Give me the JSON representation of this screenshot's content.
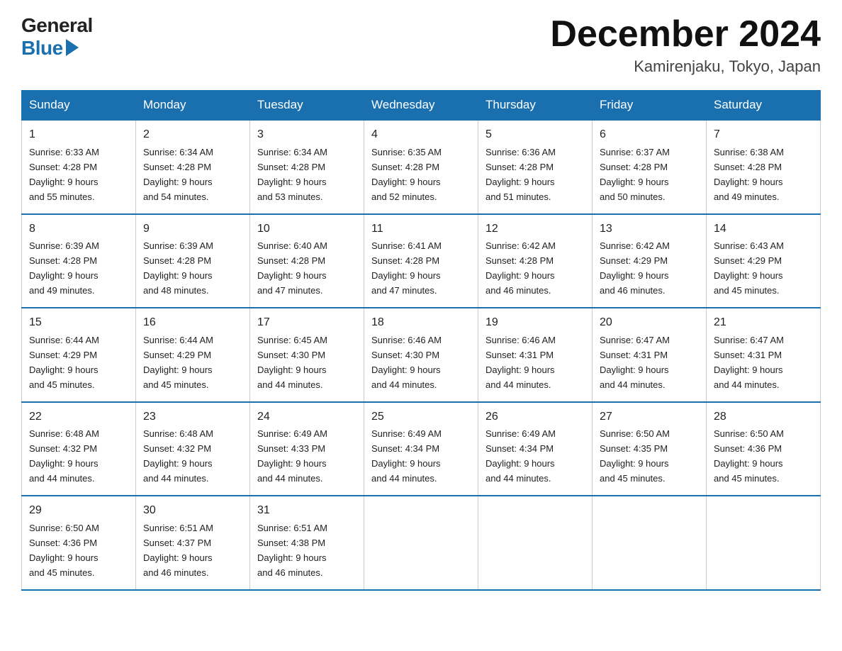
{
  "header": {
    "logo_line1": "General",
    "logo_line2": "Blue",
    "month_title": "December 2024",
    "location": "Kamirenjaku, Tokyo, Japan"
  },
  "days_of_week": [
    "Sunday",
    "Monday",
    "Tuesday",
    "Wednesday",
    "Thursday",
    "Friday",
    "Saturday"
  ],
  "weeks": [
    [
      {
        "day": "1",
        "sunrise": "6:33 AM",
        "sunset": "4:28 PM",
        "daylight": "9 hours and 55 minutes."
      },
      {
        "day": "2",
        "sunrise": "6:34 AM",
        "sunset": "4:28 PM",
        "daylight": "9 hours and 54 minutes."
      },
      {
        "day": "3",
        "sunrise": "6:34 AM",
        "sunset": "4:28 PM",
        "daylight": "9 hours and 53 minutes."
      },
      {
        "day": "4",
        "sunrise": "6:35 AM",
        "sunset": "4:28 PM",
        "daylight": "9 hours and 52 minutes."
      },
      {
        "day": "5",
        "sunrise": "6:36 AM",
        "sunset": "4:28 PM",
        "daylight": "9 hours and 51 minutes."
      },
      {
        "day": "6",
        "sunrise": "6:37 AM",
        "sunset": "4:28 PM",
        "daylight": "9 hours and 50 minutes."
      },
      {
        "day": "7",
        "sunrise": "6:38 AM",
        "sunset": "4:28 PM",
        "daylight": "9 hours and 49 minutes."
      }
    ],
    [
      {
        "day": "8",
        "sunrise": "6:39 AM",
        "sunset": "4:28 PM",
        "daylight": "9 hours and 49 minutes."
      },
      {
        "day": "9",
        "sunrise": "6:39 AM",
        "sunset": "4:28 PM",
        "daylight": "9 hours and 48 minutes."
      },
      {
        "day": "10",
        "sunrise": "6:40 AM",
        "sunset": "4:28 PM",
        "daylight": "9 hours and 47 minutes."
      },
      {
        "day": "11",
        "sunrise": "6:41 AM",
        "sunset": "4:28 PM",
        "daylight": "9 hours and 47 minutes."
      },
      {
        "day": "12",
        "sunrise": "6:42 AM",
        "sunset": "4:28 PM",
        "daylight": "9 hours and 46 minutes."
      },
      {
        "day": "13",
        "sunrise": "6:42 AM",
        "sunset": "4:29 PM",
        "daylight": "9 hours and 46 minutes."
      },
      {
        "day": "14",
        "sunrise": "6:43 AM",
        "sunset": "4:29 PM",
        "daylight": "9 hours and 45 minutes."
      }
    ],
    [
      {
        "day": "15",
        "sunrise": "6:44 AM",
        "sunset": "4:29 PM",
        "daylight": "9 hours and 45 minutes."
      },
      {
        "day": "16",
        "sunrise": "6:44 AM",
        "sunset": "4:29 PM",
        "daylight": "9 hours and 45 minutes."
      },
      {
        "day": "17",
        "sunrise": "6:45 AM",
        "sunset": "4:30 PM",
        "daylight": "9 hours and 44 minutes."
      },
      {
        "day": "18",
        "sunrise": "6:46 AM",
        "sunset": "4:30 PM",
        "daylight": "9 hours and 44 minutes."
      },
      {
        "day": "19",
        "sunrise": "6:46 AM",
        "sunset": "4:31 PM",
        "daylight": "9 hours and 44 minutes."
      },
      {
        "day": "20",
        "sunrise": "6:47 AM",
        "sunset": "4:31 PM",
        "daylight": "9 hours and 44 minutes."
      },
      {
        "day": "21",
        "sunrise": "6:47 AM",
        "sunset": "4:31 PM",
        "daylight": "9 hours and 44 minutes."
      }
    ],
    [
      {
        "day": "22",
        "sunrise": "6:48 AM",
        "sunset": "4:32 PM",
        "daylight": "9 hours and 44 minutes."
      },
      {
        "day": "23",
        "sunrise": "6:48 AM",
        "sunset": "4:32 PM",
        "daylight": "9 hours and 44 minutes."
      },
      {
        "day": "24",
        "sunrise": "6:49 AM",
        "sunset": "4:33 PM",
        "daylight": "9 hours and 44 minutes."
      },
      {
        "day": "25",
        "sunrise": "6:49 AM",
        "sunset": "4:34 PM",
        "daylight": "9 hours and 44 minutes."
      },
      {
        "day": "26",
        "sunrise": "6:49 AM",
        "sunset": "4:34 PM",
        "daylight": "9 hours and 44 minutes."
      },
      {
        "day": "27",
        "sunrise": "6:50 AM",
        "sunset": "4:35 PM",
        "daylight": "9 hours and 45 minutes."
      },
      {
        "day": "28",
        "sunrise": "6:50 AM",
        "sunset": "4:36 PM",
        "daylight": "9 hours and 45 minutes."
      }
    ],
    [
      {
        "day": "29",
        "sunrise": "6:50 AM",
        "sunset": "4:36 PM",
        "daylight": "9 hours and 45 minutes."
      },
      {
        "day": "30",
        "sunrise": "6:51 AM",
        "sunset": "4:37 PM",
        "daylight": "9 hours and 46 minutes."
      },
      {
        "day": "31",
        "sunrise": "6:51 AM",
        "sunset": "4:38 PM",
        "daylight": "9 hours and 46 minutes."
      },
      null,
      null,
      null,
      null
    ]
  ],
  "labels": {
    "sunrise": "Sunrise:",
    "sunset": "Sunset:",
    "daylight": "Daylight:"
  }
}
